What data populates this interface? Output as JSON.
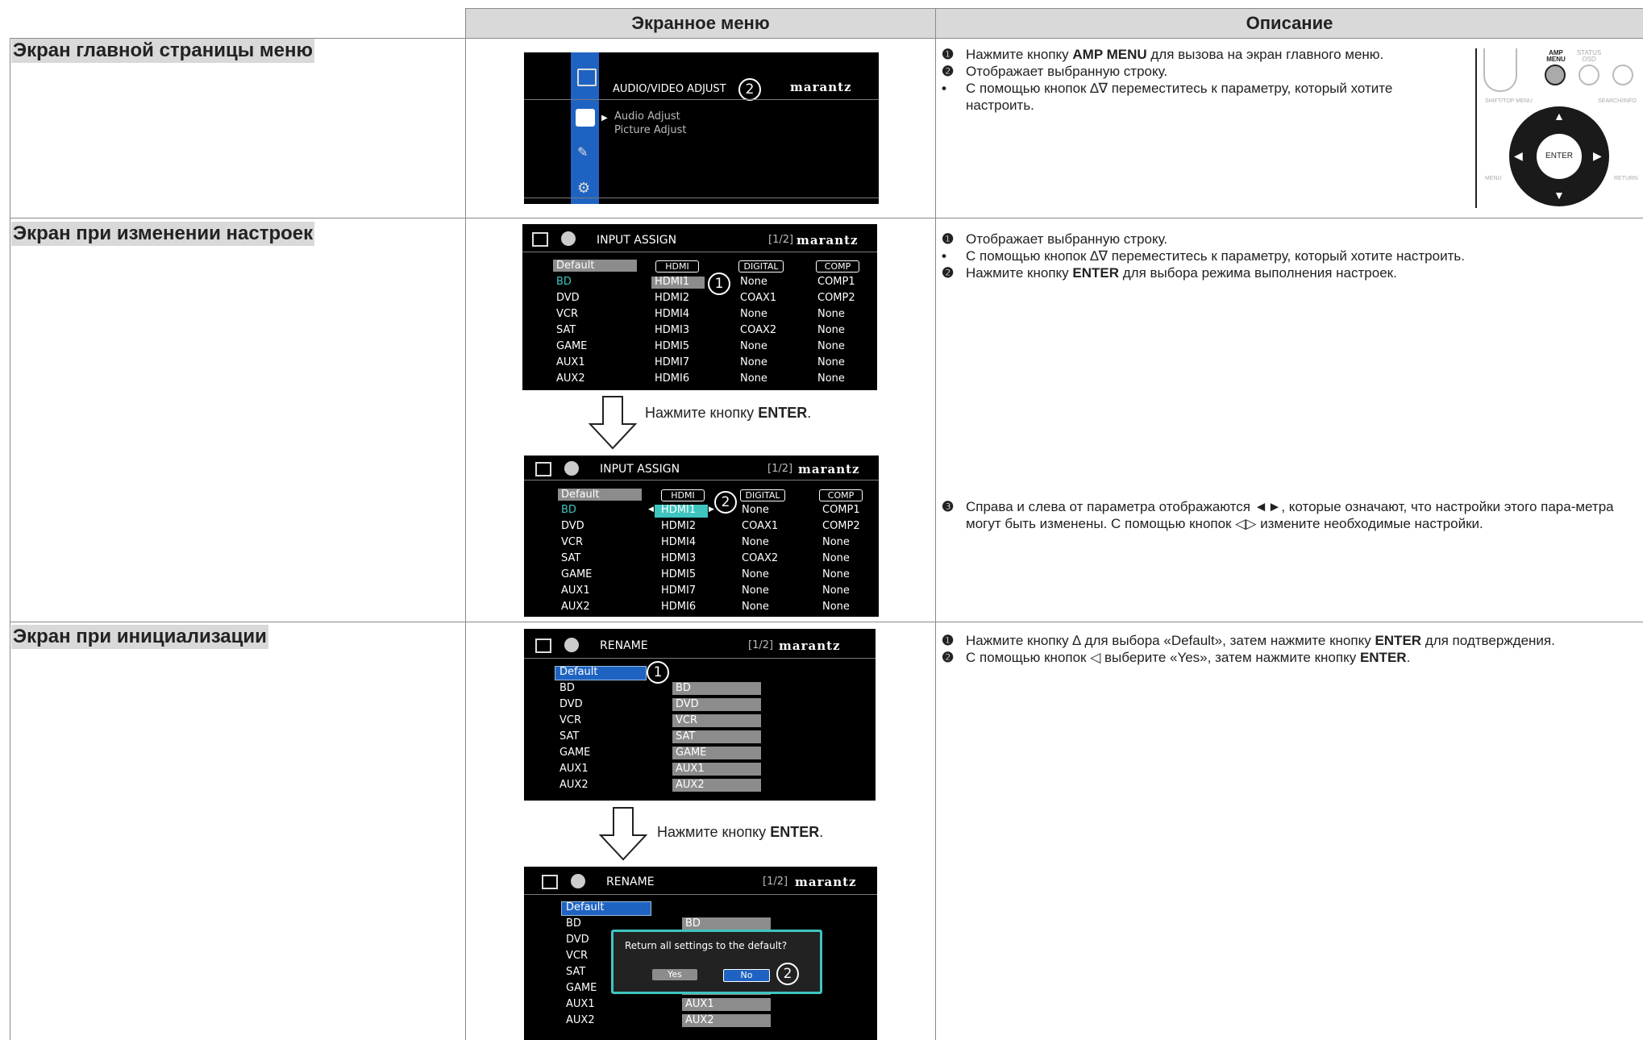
{
  "header": {
    "col_screen": "Экранное меню",
    "col_desc": "Описание"
  },
  "rows": {
    "r1_title": "Экран главной страницы меню",
    "r2_title": "Экран при изменении настроек",
    "r3_title": "Экран при инициализации"
  },
  "osd_main": {
    "title": "AUDIO/VIDEO ADJUST",
    "brand": "marantz",
    "items": [
      "Audio Adjust",
      "Picture Adjust"
    ],
    "callout": "2"
  },
  "osd_assign": {
    "title": "INPUT ASSIGN",
    "page": "[1/2]",
    "brand": "marantz",
    "default_label": "Default",
    "col_heads": [
      "HDMI",
      "DIGITAL",
      "COMP"
    ],
    "rows": [
      [
        "BD",
        "HDMI1",
        "None",
        "COMP1"
      ],
      [
        "DVD",
        "HDMI2",
        "COAX1",
        "COMP2"
      ],
      [
        "VCR",
        "HDMI4",
        "None",
        "None"
      ],
      [
        "SAT",
        "HDMI3",
        "COAX2",
        "None"
      ],
      [
        "GAME",
        "HDMI5",
        "None",
        "None"
      ],
      [
        "AUX1",
        "HDMI7",
        "None",
        "None"
      ],
      [
        "AUX2",
        "HDMI6",
        "None",
        "None"
      ]
    ],
    "callout_1": "1",
    "callout_2": "2"
  },
  "osd_rename": {
    "title": "RENAME",
    "page": "[1/2]",
    "brand": "marantz",
    "default_label": "Default",
    "rows": [
      [
        "BD",
        "BD"
      ],
      [
        "DVD",
        "DVD"
      ],
      [
        "VCR",
        "VCR"
      ],
      [
        "SAT",
        "SAT"
      ],
      [
        "GAME",
        "GAME"
      ],
      [
        "AUX1",
        "AUX1"
      ],
      [
        "AUX2",
        "AUX2"
      ]
    ],
    "dialog_text": "Return all settings to the default?",
    "yes": "Yes",
    "no": "No",
    "callout_1": "1",
    "callout_2": "2"
  },
  "captions": {
    "press_pre": "Нажмите кнопку ",
    "press_key": "ENTER",
    "press_post": "."
  },
  "desc1": {
    "m1": "❶",
    "l1_pre": "Нажмите кнопку ",
    "l1_key": "AMP MENU",
    "l1_post": " для вызова на экран главного меню.",
    "m2": "❷",
    "l2": "Отображает выбранную строку.",
    "m3": "•",
    "l3": "С помощью кнопок ∆∇ переместитесь к параметру, который хотите настроить."
  },
  "desc2": {
    "m1": "❶",
    "l1": "Отображает выбранную строку.",
    "m2": "•",
    "l2": "С помощью кнопок ∆∇ переместитесь к параметру, который хотите настроить.",
    "m3": "❷",
    "l3_pre": "Нажмите кнопку ",
    "l3_key": "ENTER",
    "l3_post": "  для выбора режима выполнения настроек.",
    "m4": "❸",
    "l4": "Справа и слева от параметра отображаются ◄►, которые означают, что настройки этого пара-метра могут быть изменены.  С помощью кнопок ◁▷ измените необходимые настройки."
  },
  "desc3": {
    "m1": "❶",
    "l1_pre": "Нажмите кнопку ∆ для выбора «Default», затем нажмите кнопку ",
    "l1_key": "ENTER",
    "l1_post": " для подтверждения.",
    "m2": "❷",
    "l2_pre": "С помощью кнопок ◁ выберите «Yes», затем нажмите кнопку ",
    "l2_key": "ENTER",
    "l2_post": "."
  },
  "remote": {
    "amp_menu": "AMP MENU",
    "status_osd": "STATUS OSD",
    "shift_top_menu": "SHIFT/TOP MENU",
    "search_info": "SEARCH/INFO",
    "enter": "ENTER",
    "menu": "MENU",
    "return": "RETURN"
  }
}
